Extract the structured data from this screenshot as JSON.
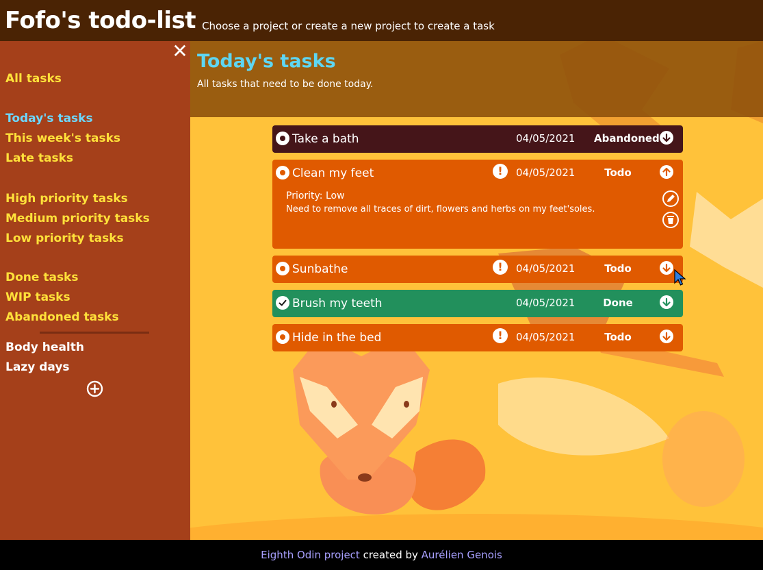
{
  "header": {
    "title": "Fofo's todo-list",
    "subtitle": "Choose a project or create a new project to create a task"
  },
  "sidebar": {
    "groups": [
      [
        "All tasks"
      ],
      [
        "Today's tasks",
        "This week's tasks",
        "Late tasks"
      ],
      [
        "High priority tasks",
        "Medium priority tasks",
        "Low priority tasks"
      ],
      [
        "Done tasks",
        "WIP tasks",
        "Abandoned tasks"
      ]
    ],
    "active": "Today's tasks",
    "projects": [
      "Body health",
      "Lazy days"
    ],
    "close_icon": "close-icon",
    "add_icon": "add-circle-icon"
  },
  "page": {
    "title": "Today's tasks",
    "description": "All tasks that need to be done today."
  },
  "tasks": [
    {
      "name": "Take a bath",
      "date": "04/05/2021",
      "status": "Abandoned",
      "has_priority_icon": false,
      "expanded": false
    },
    {
      "name": "Clean my feet",
      "date": "04/05/2021",
      "status": "Todo",
      "has_priority_icon": true,
      "expanded": true,
      "priority": "Priority: Low",
      "description": "Need to remove all traces of dirt, flowers and herbs on my feet'soles."
    },
    {
      "name": "Sunbathe",
      "date": "04/05/2021",
      "status": "Todo",
      "has_priority_icon": true,
      "expanded": false
    },
    {
      "name": "Brush my teeth",
      "date": "04/05/2021",
      "status": "Done",
      "has_priority_icon": false,
      "expanded": false
    },
    {
      "name": "Hide in the bed",
      "date": "04/05/2021",
      "status": "Todo",
      "has_priority_icon": true,
      "expanded": false
    }
  ],
  "footer": {
    "project_link": "Eighth Odin project",
    "middle": " created by ",
    "author_link": "Aurélien Genois"
  },
  "colors": {
    "header_bg": "#4a2304",
    "sidebar_bg": "#a5401a",
    "main_bg": "#ffc23a",
    "link_yellow": "#ffe13a",
    "active_blue": "#6cd8ff",
    "task_abandoned": "#451519",
    "task_todo": "#e05a00",
    "task_done": "#22905c"
  }
}
